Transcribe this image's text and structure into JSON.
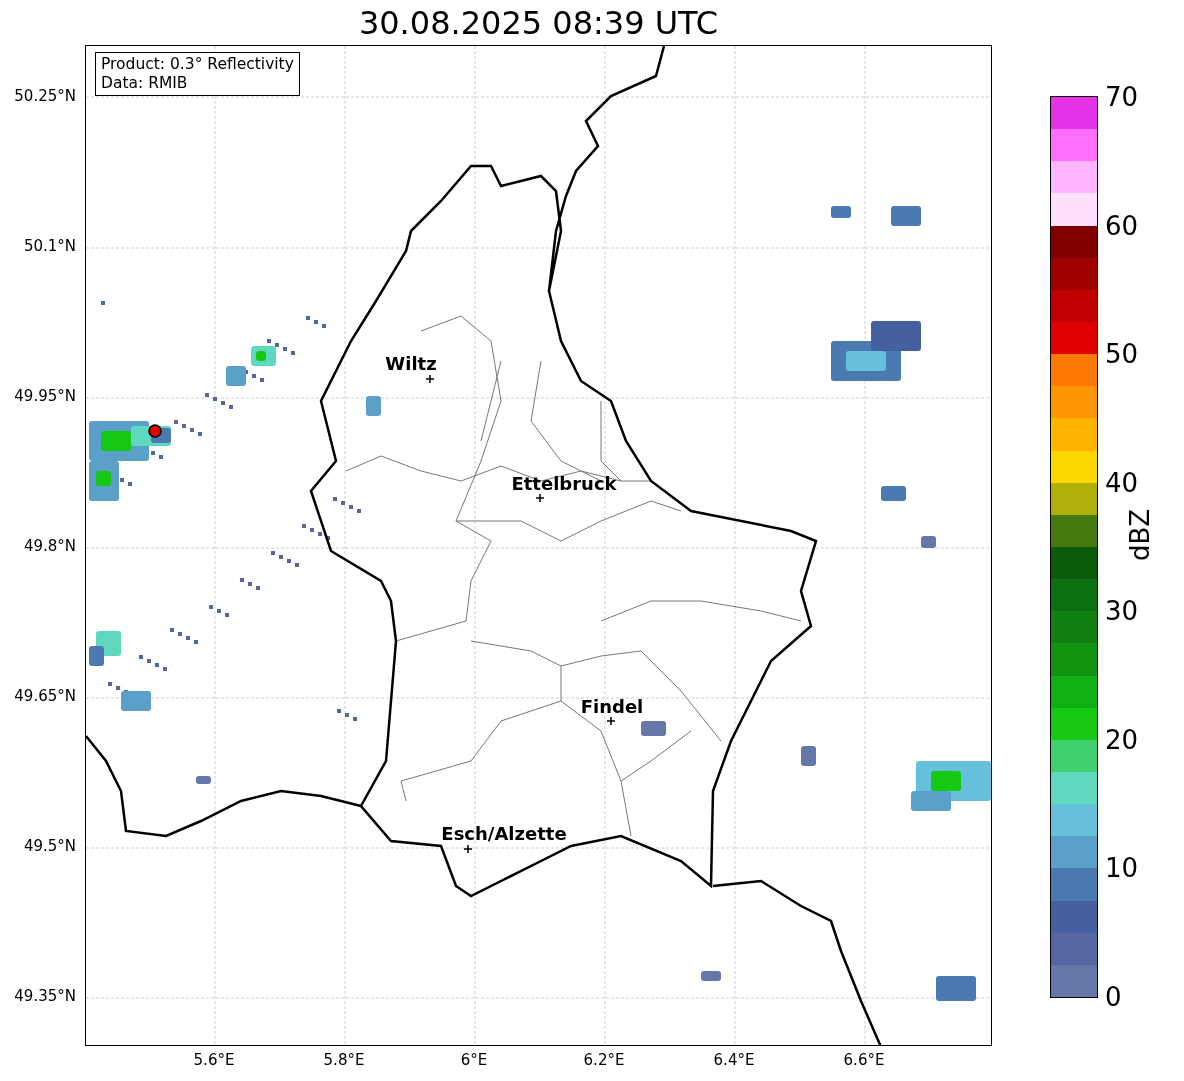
{
  "title": "30.08.2025 08:39 UTC",
  "info_box": [
    "Product: 0.3° Reflectivity",
    "Data: RMIB"
  ],
  "lat_ticks": [
    "50.25°N",
    "50.1°N",
    "49.95°N",
    "49.8°N",
    "49.65°N",
    "49.5°N",
    "49.35°N"
  ],
  "lon_ticks": [
    "5.6°E",
    "5.8°E",
    "6°E",
    "6.2°E",
    "6.4°E",
    "6.6°E"
  ],
  "cities": [
    {
      "name": "Wiltz"
    },
    {
      "name": "Ettelbruck"
    },
    {
      "name": "Findel"
    },
    {
      "name": "Esch/Alzette"
    }
  ],
  "colorbar": {
    "label": "dBZ",
    "ticks": [
      "70",
      "60",
      "50",
      "40",
      "30",
      "20",
      "10",
      "0"
    ],
    "bins": [
      {
        "color": "#6577a8"
      },
      {
        "color": "#5566a0"
      },
      {
        "color": "#4560a0"
      },
      {
        "color": "#4a7ab0"
      },
      {
        "color": "#5aa0c8"
      },
      {
        "color": "#65c0dc"
      },
      {
        "color": "#60d8c0"
      },
      {
        "color": "#40d070"
      },
      {
        "color": "#14c814"
      },
      {
        "color": "#10b014"
      },
      {
        "color": "#109410"
      },
      {
        "color": "#108010"
      },
      {
        "color": "#0a7010"
      },
      {
        "color": "#0a5a0a"
      },
      {
        "color": "#457a10"
      },
      {
        "color": "#b0b008"
      },
      {
        "color": "#ffd700"
      },
      {
        "color": "#ffb400"
      },
      {
        "color": "#ff9600"
      },
      {
        "color": "#ff7800"
      },
      {
        "color": "#e00000"
      },
      {
        "color": "#c00000"
      },
      {
        "color": "#a00000"
      },
      {
        "color": "#800000"
      },
      {
        "color": "#ffe0ff"
      },
      {
        "color": "#ffb4ff"
      },
      {
        "color": "#ff6eff"
      },
      {
        "color": "#e632e6"
      }
    ]
  }
}
